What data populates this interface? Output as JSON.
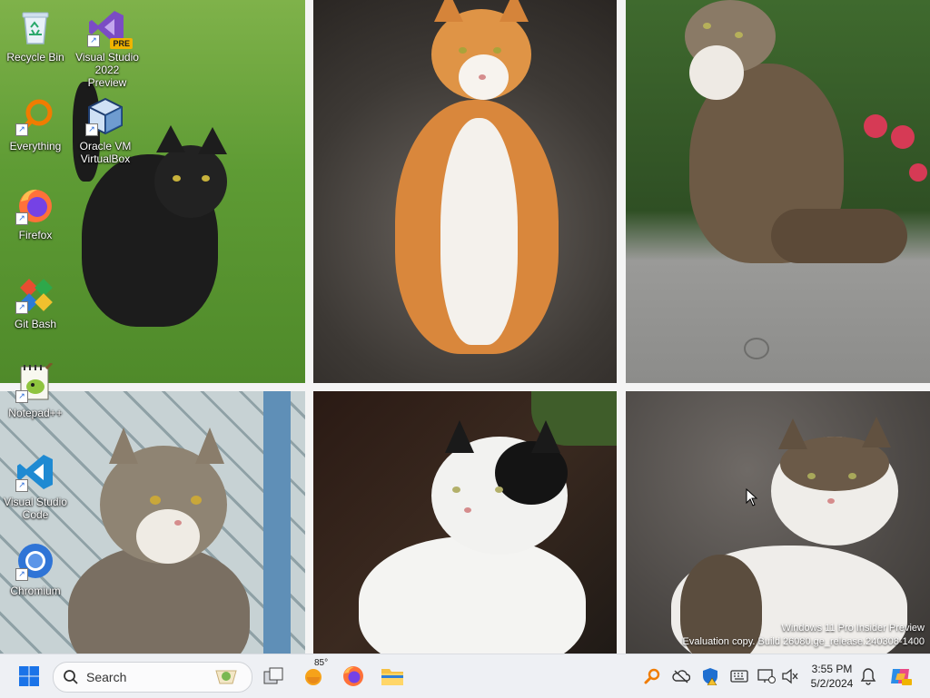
{
  "desktop": {
    "icons": [
      {
        "id": "recycle-bin",
        "label": "Recycle Bin"
      },
      {
        "id": "visual-studio-2022-preview",
        "label": "Visual Studio 2022 Preview",
        "badge": "PRE"
      },
      {
        "id": "everything",
        "label": "Everything"
      },
      {
        "id": "oracle-vm-virtualbox",
        "label": "Oracle VM VirtualBox"
      },
      {
        "id": "firefox",
        "label": "Firefox"
      },
      {
        "id": "git-bash",
        "label": "Git Bash"
      },
      {
        "id": "notepad-plus-plus",
        "label": "Notepad++"
      },
      {
        "id": "visual-studio-code",
        "label": "Visual Studio Code"
      },
      {
        "id": "chromium",
        "label": "Chromium"
      }
    ]
  },
  "watermark": {
    "line1": "Windows 11 Pro Insider Preview",
    "line2": "Evaluation copy. Build 26080.ge_release.240308-1400"
  },
  "taskbar": {
    "search_placeholder": "Search",
    "weather_temp": "85°",
    "clock_time": "3:55 PM",
    "clock_date": "5/2/2024",
    "pinned": [
      "start-icon",
      "search-icon",
      "task-view-icon",
      "weather-icon",
      "firefox-icon",
      "file-explorer-icon"
    ],
    "tray": [
      "everything-tray-icon",
      "onedrive-icon",
      "defender-warning-icon",
      "keyboard-icon",
      "network-icon",
      "volume-muted-icon",
      "notification-bell-icon",
      "copilot-icon"
    ]
  },
  "colors": {
    "taskbar_bg": "#eef0f4",
    "accent": "#0078d4"
  }
}
